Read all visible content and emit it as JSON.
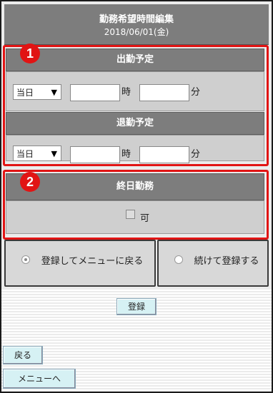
{
  "header": {
    "title": "勤務希望時間編集",
    "date": "2018/06/01(金)"
  },
  "badges": {
    "one": "1",
    "two": "2"
  },
  "start": {
    "heading": "出勤予定",
    "day_select": "当日",
    "hour_unit": "時",
    "minute_unit": "分",
    "hour_value": "",
    "minute_value": ""
  },
  "end": {
    "heading": "退勤予定",
    "day_select": "当日",
    "hour_unit": "時",
    "minute_unit": "分",
    "hour_value": "",
    "minute_value": ""
  },
  "allday": {
    "heading": "終日勤務",
    "checkbox_label": "可",
    "checked": false
  },
  "radio": {
    "option1": "登録してメニューに戻る",
    "option2": "続けて登録する",
    "selected": "option1"
  },
  "buttons": {
    "register": "登録",
    "back": "戻る",
    "menu": "メニューへ"
  },
  "colors": {
    "highlight": "#e11414",
    "header_bg": "#7d7d7d",
    "button_bg": "#d6f1f4"
  }
}
